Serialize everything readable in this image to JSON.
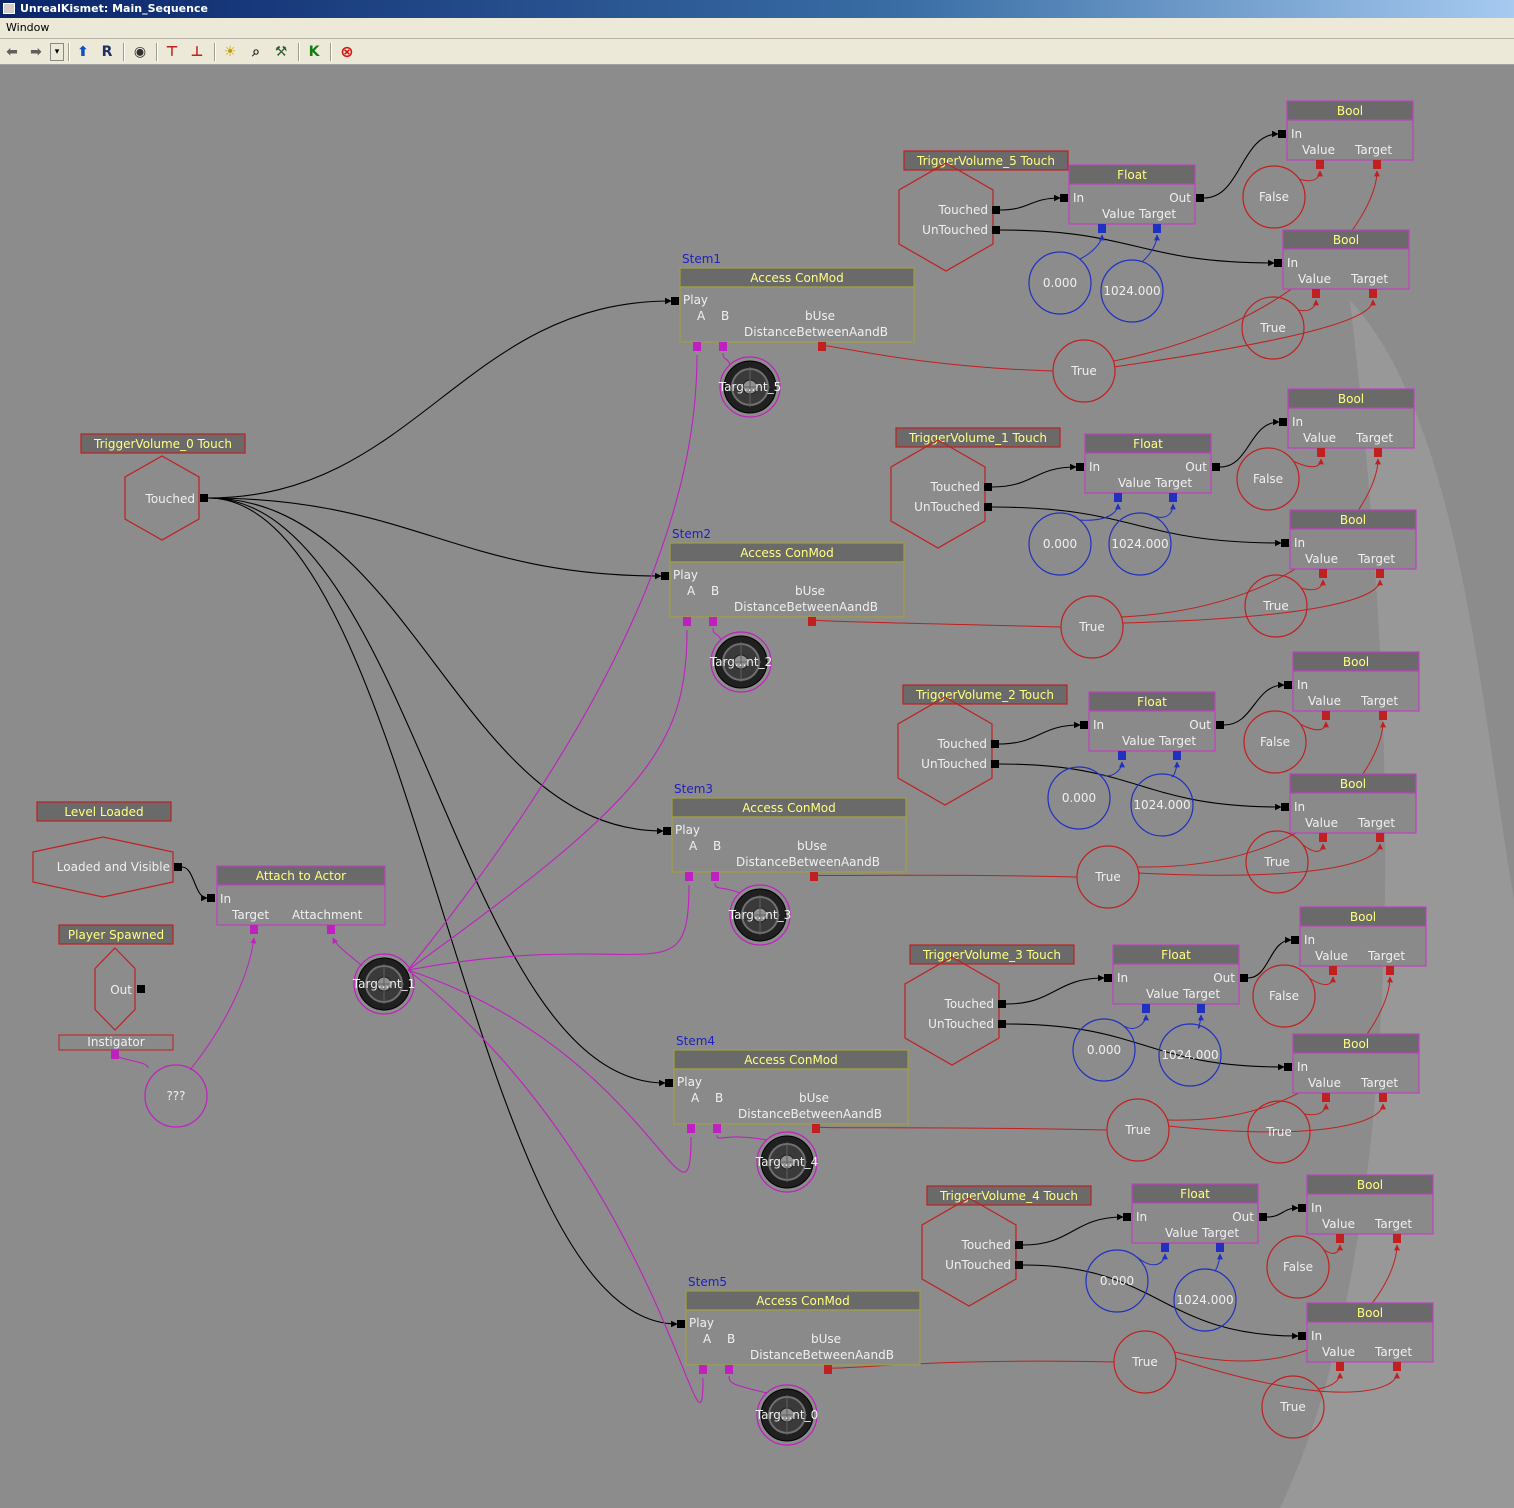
{
  "window": {
    "title": "UnrealKismet: Main_Sequence"
  },
  "menu": [
    "Window"
  ],
  "toolbar": {
    "buttons": [
      "back-arrow-icon",
      "forward-arrow-icon",
      "history-dropdown-icon",
      "parent-sequence-icon",
      "rename-icon",
      "eye-icon",
      "hierarchy-up-icon",
      "hierarchy-down-icon",
      "lightbulb-icon",
      "search-icon",
      "wrench-icon",
      "kismet-k-icon",
      "close-circle-icon"
    ],
    "rename_label": "R",
    "kismet_label": "K"
  },
  "colors": {
    "canvas": "#8c8c8c",
    "event_border": "#c02020",
    "event_label": "#ffff80",
    "action_border": "#a0a040",
    "bool_border": "#c040c0",
    "var_blue": "#2030c0",
    "var_red": "#c02020",
    "wire_magenta": "#c020c0"
  },
  "labels": {
    "touched": "Touched",
    "untouched": "UnTouched",
    "play": "Play",
    "a": "A",
    "b": "B",
    "buse": "bUse",
    "distance": "DistanceBetweenAandB",
    "in": "In",
    "out": "Out",
    "value": "Value",
    "target": "Target",
    "attachment": "Attachment",
    "access_conmod": "Access ConMod",
    "float": "Float",
    "bool": "Bool",
    "true": "True",
    "false": "False",
    "float_zero": "0.000",
    "float_1024": "1024.000"
  },
  "level_loaded": {
    "title": "Level Loaded",
    "output": "Loaded and Visible"
  },
  "player_spawned": {
    "title": "Player Spawned",
    "output": "Out",
    "var": "Instigator",
    "unknown": "???"
  },
  "attach": {
    "title": "Attach to Actor"
  },
  "trigger0": {
    "title": "TriggerVolume_0 Touch"
  },
  "targets": [
    "Targ...nt_1",
    "Targ...nt_5",
    "Targ...nt_2",
    "Targ...nt_3",
    "Targ...nt_4",
    "Targ...nt_0"
  ],
  "stems": [
    "Stem1",
    "Stem2",
    "Stem3",
    "Stem4",
    "Stem5"
  ],
  "triggers": [
    "TriggerVolume_5 Touch",
    "TriggerVolume_1 Touch",
    "TriggerVolume_2 Touch",
    "TriggerVolume_3 Touch",
    "TriggerVolume_4 Touch"
  ]
}
